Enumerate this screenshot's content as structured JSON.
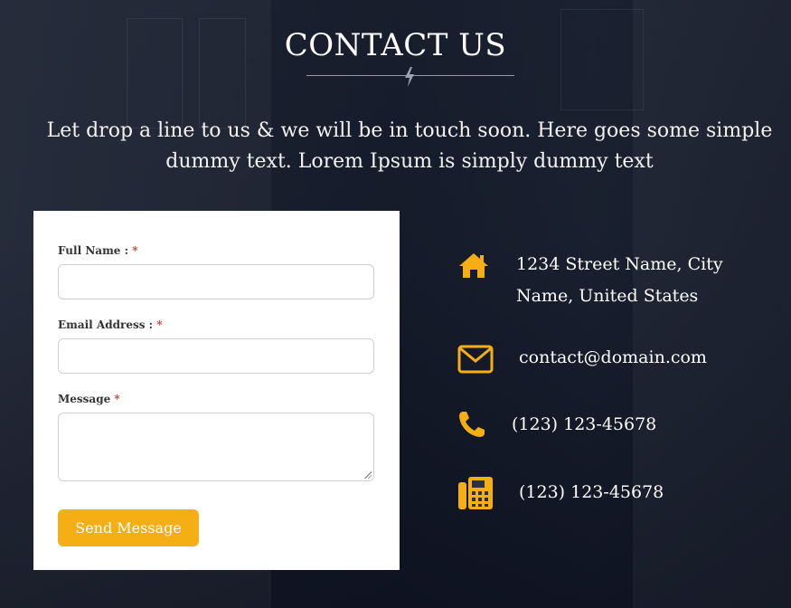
{
  "header": {
    "title": "CONTACT US",
    "intro": "Let drop a line to us & we will be in touch soon. Here goes some simple dummy text. Lorem Ipsum is simply dummy text"
  },
  "form": {
    "full_name_label": "Full Name : ",
    "email_label": "Email Address : ",
    "message_label": "Message ",
    "required_marker": "*",
    "full_name_value": "",
    "email_value": "",
    "message_value": "",
    "send_label": "Send Message"
  },
  "contact": {
    "address": "1234 Street Name, City Name, United States",
    "email": "contact@domain.com",
    "phone": "(123) 123-45678",
    "fax": "(123) 123-45678"
  },
  "colors": {
    "accent": "#f6ae15",
    "required": "#d9372b"
  },
  "icons": [
    "lightning-bolt-icon",
    "home-icon",
    "envelope-icon",
    "phone-icon",
    "fax-icon"
  ]
}
